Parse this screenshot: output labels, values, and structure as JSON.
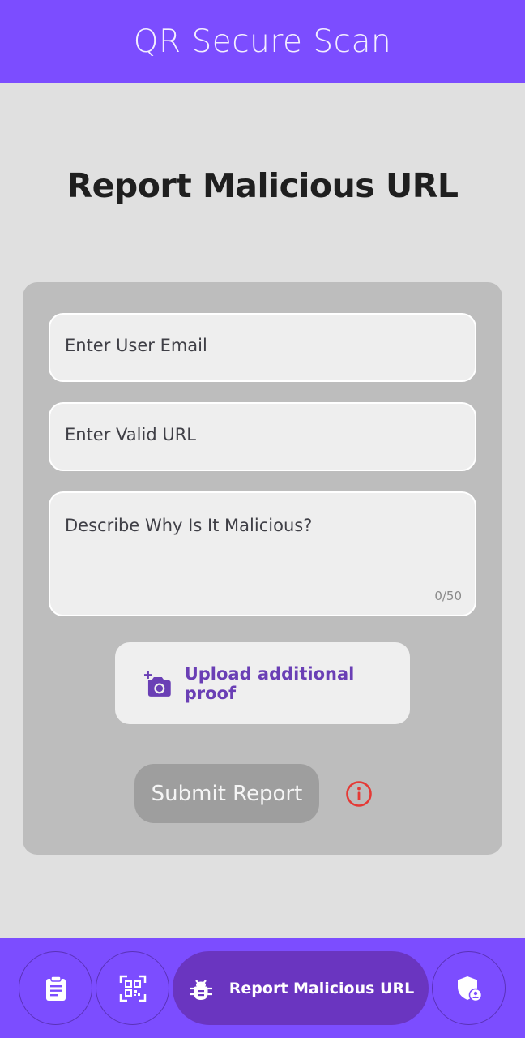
{
  "appbar": {
    "title": "QR Secure Scan"
  },
  "page": {
    "title": "Report Malicious URL"
  },
  "form": {
    "email_placeholder": "Enter User Email",
    "url_placeholder": "Enter Valid URL",
    "description_placeholder": "Describe Why Is It Malicious?",
    "description_counter": "0/50",
    "upload_label": "Upload additional proof",
    "submit_label": "Submit Report"
  },
  "bottom_nav": {
    "items": [
      {
        "icon": "clipboard-icon"
      },
      {
        "icon": "qr-scan-icon"
      },
      {
        "icon": "bug-icon",
        "label": "Report Malicious URL",
        "active": true
      },
      {
        "icon": "shield-user-icon"
      }
    ]
  },
  "colors": {
    "primary": "#7c4dff",
    "active_nav": "#6a35c0",
    "card": "#bdbdbd",
    "background": "#e0e0e0",
    "upload_text": "#6a3fb5",
    "info_icon": "#e53935",
    "submit_disabled": "#9e9e9e"
  }
}
